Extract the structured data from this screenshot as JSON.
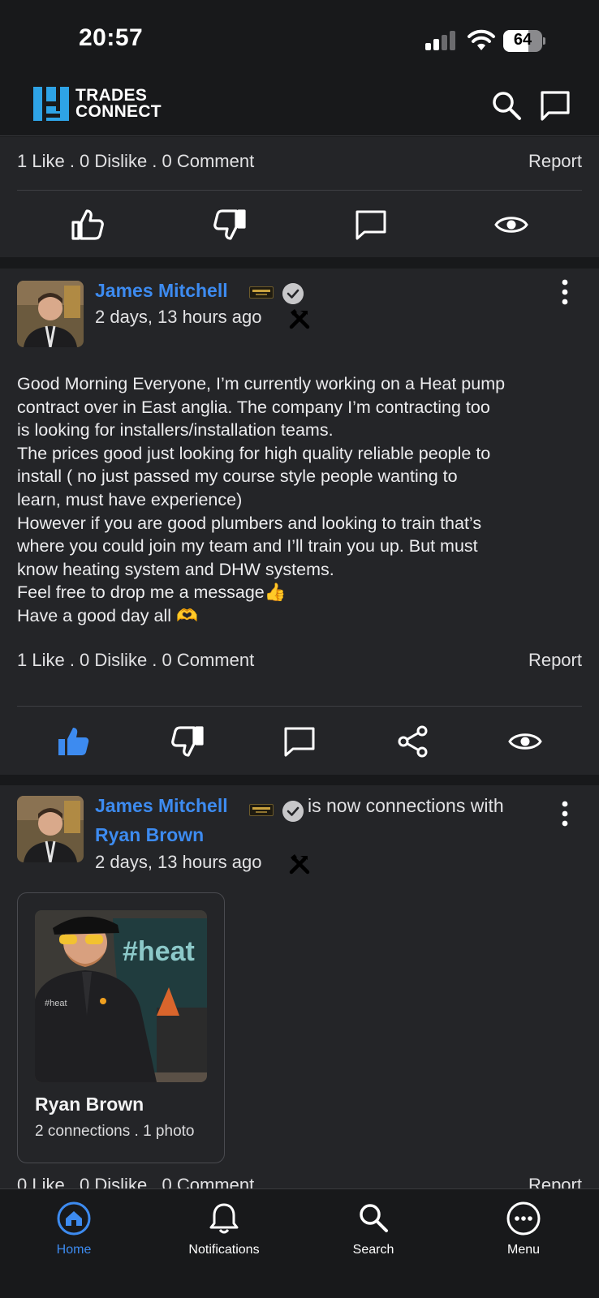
{
  "status_bar": {
    "time": "20:57",
    "battery": "64"
  },
  "header": {
    "logo_line1": "TRADES",
    "logo_line2": "CONNECT"
  },
  "top_post": {
    "stats": "1 Like . 0 Dislike . 0 Comment",
    "report_label": "Report"
  },
  "post_1": {
    "author": "James Mitchell",
    "timestamp": "2 days, 13 hours ago",
    "body_lines": [
      "Good Morning Everyone, I’m currently working on a Heat pump",
      "contract over in East anglia. The company I’m contracting too",
      "is looking for installers/installation teams.",
      "The prices good just looking for high quality reliable people to",
      "install ( no just passed my course style people wanting to",
      "learn, must have experience)",
      "However if you are good plumbers and looking to train that’s",
      "where you could join my team and I’ll train you up. But must",
      "know heating system and DHW systems.",
      "Feel free to drop me a message👍",
      "Have a good day all 🫶"
    ],
    "stats": "1 Like . 0 Dislike . 0 Comment",
    "report_label": "Report"
  },
  "post_2": {
    "author": "James Mitchell",
    "connection_text": "is now connections with",
    "connected_name": "Ryan Brown",
    "timestamp": "2 days, 13 hours ago",
    "card": {
      "name": "Ryan Brown",
      "meta": "2 connections . 1 photo",
      "van_text": "#heat",
      "jumper_text": "#heat"
    },
    "peek_stats": "0 Like . 0 Dislike . 0 Comment",
    "peek_report": "Report"
  },
  "tabs": [
    {
      "label": "Home",
      "icon": "home-icon",
      "active": true
    },
    {
      "label": "Notifications",
      "icon": "bell-icon",
      "active": false
    },
    {
      "label": "Search",
      "icon": "search-icon",
      "active": false
    },
    {
      "label": "Menu",
      "icon": "menu-icon",
      "active": false
    }
  ],
  "colors": {
    "accent": "#3d8bf0",
    "background": "#18191b",
    "card": "#242528",
    "logo_blue": "#2ea3e6"
  }
}
